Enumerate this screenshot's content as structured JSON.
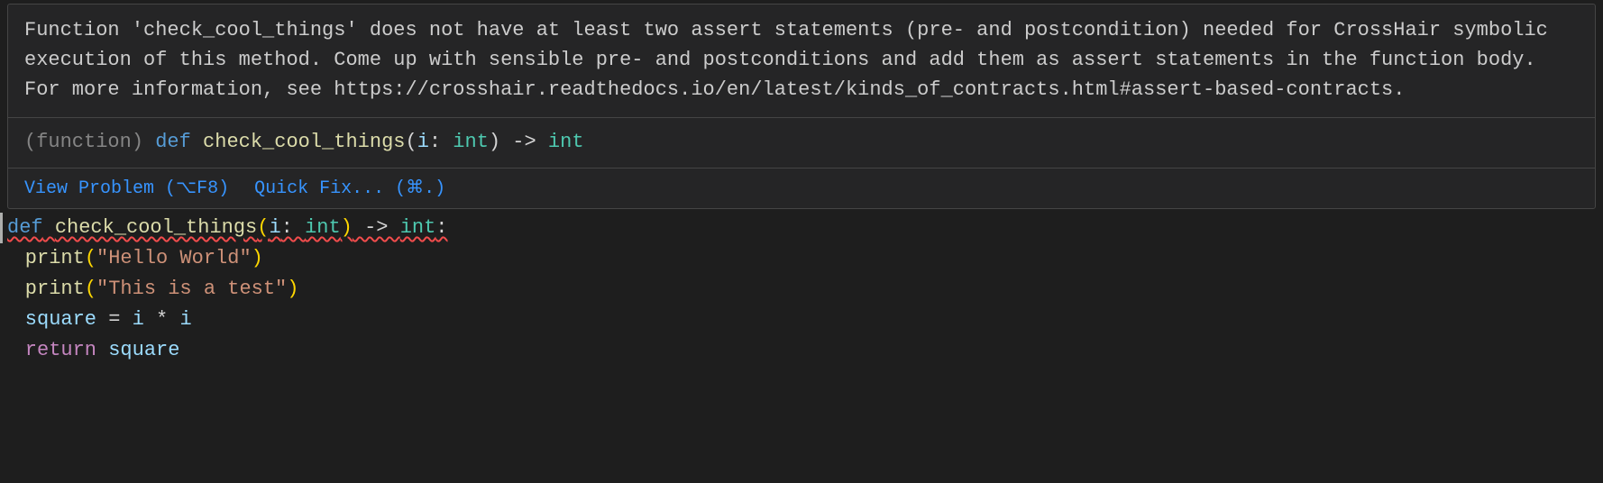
{
  "hover": {
    "message": "Function 'check_cool_things' does not have at least two assert statements (pre- and postcondition) needed for CrossHair symbolic execution of this method. Come up with sensible pre- and postconditions and add them as assert statements in the function body. For more information, see https://crosshair.readthedocs.io/en/latest/kinds_of_contracts.html#assert-based-contracts.",
    "signature": {
      "prefix": "(function) ",
      "def": "def",
      "name": "check_cool_things",
      "open": "(",
      "param": "i",
      "colon1": ": ",
      "ptype": "int",
      "close": ")",
      "arrow": " -> ",
      "rtype": "int"
    },
    "actions": {
      "view_problem": "View Problem (⌥F8)",
      "quick_fix": "Quick Fix... (⌘.)"
    }
  },
  "code": {
    "l1": {
      "def": "def",
      "sp": " ",
      "name": "check_cool_things",
      "open": "(",
      "param": "i",
      "colon": ": ",
      "ptype": "int",
      "close": ")",
      "arrow": " -> ",
      "rtype": "int",
      "end": ":"
    },
    "l2": {
      "fn": "print",
      "open": "(",
      "str": "\"Hello World\"",
      "close": ")"
    },
    "l3": {
      "fn": "print",
      "open": "(",
      "str": "\"This is a test\"",
      "close": ")"
    },
    "l4": {
      "var": "square",
      "eq": " = ",
      "a": "i",
      "op": " * ",
      "b": "i"
    },
    "l5": {
      "ret": "return",
      "sp": " ",
      "var": "square"
    }
  }
}
